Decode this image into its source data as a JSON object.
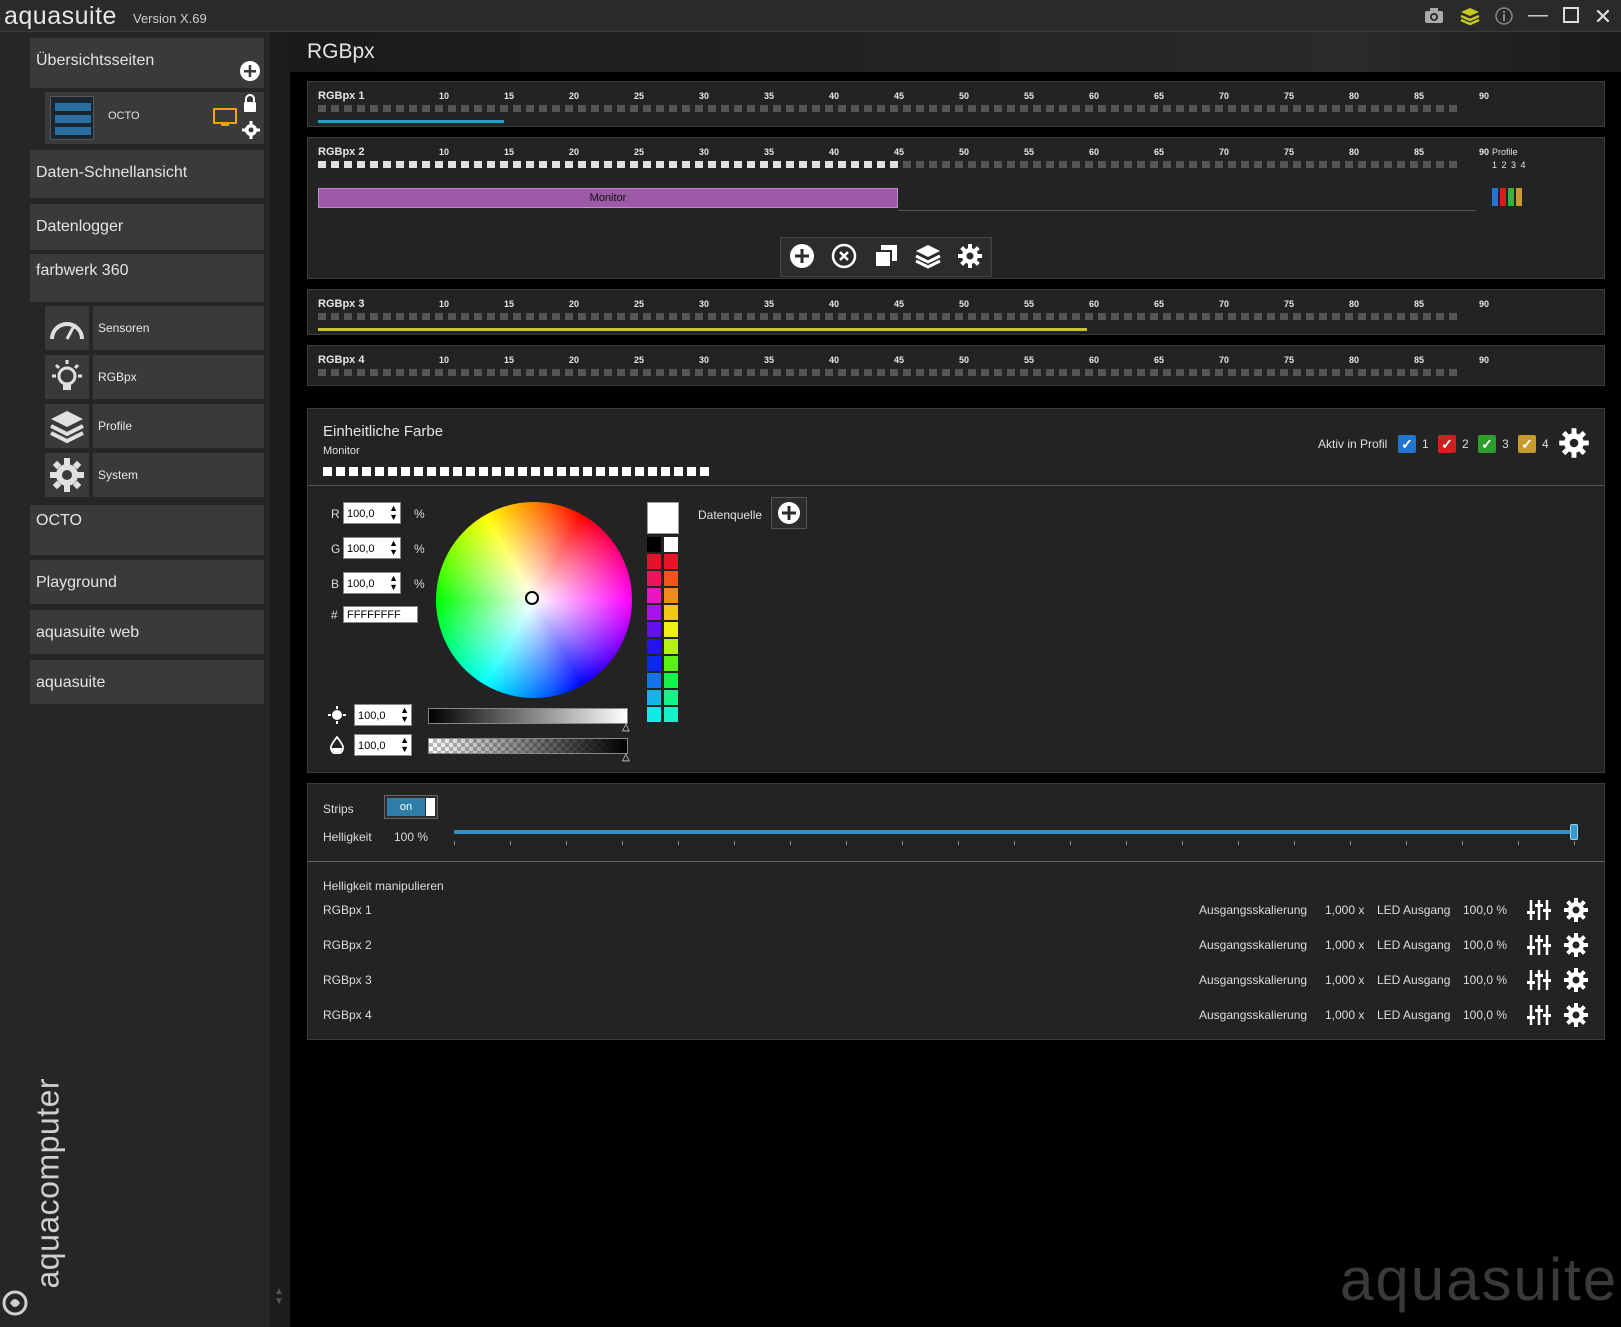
{
  "app": {
    "name": "aquasuite",
    "version": "Version X.69"
  },
  "sidebar": {
    "overview_title": "Übersichtsseiten",
    "octo_card_label": "OCTO",
    "items": [
      {
        "label": "Daten-Schnellansicht"
      },
      {
        "label": "Datenlogger"
      },
      {
        "label": "farbwerk 360"
      }
    ],
    "sub_items": [
      {
        "label": "Sensoren"
      },
      {
        "label": "RGBpx"
      },
      {
        "label": "Profile"
      },
      {
        "label": "System"
      }
    ],
    "items_after": [
      {
        "label": "OCTO"
      },
      {
        "label": "Playground"
      },
      {
        "label": "aquasuite web"
      },
      {
        "label": "aquasuite"
      }
    ],
    "brand_vertical": "aquacomputer"
  },
  "page": {
    "title": "RGBpx"
  },
  "strips": [
    {
      "name": "RGBpx 1",
      "lit_leds": 0,
      "bar_color": "#1aa3c8",
      "bar_fraction": 0.16
    },
    {
      "name": "RGBpx 2",
      "lit_leds": 45,
      "bar_color": "",
      "bar_fraction": 0
    },
    {
      "name": "RGBpx 3",
      "lit_leds": 0,
      "bar_color": "#c7c72a",
      "bar_fraction": 0.66
    },
    {
      "name": "RGBpx 4",
      "lit_leds": 0,
      "bar_color": "",
      "bar_fraction": 0
    }
  ],
  "ticks": [
    "10",
    "15",
    "20",
    "25",
    "30",
    "35",
    "40",
    "45",
    "50",
    "55",
    "60",
    "65",
    "70",
    "75",
    "80",
    "85",
    "90"
  ],
  "strip2": {
    "profile_label": "Profile",
    "profile_numbers": "1 2 3 4",
    "effect_label": "Monitor",
    "effect_color": "#9b59a6",
    "profile_colors": [
      "#2176d2",
      "#d02020",
      "#3fae3f",
      "#c99a2e"
    ]
  },
  "effect": {
    "title": "Einheitliche Farbe",
    "subtitle": "Monitor",
    "active_in_profile_label": "Aktiv in Profil",
    "profiles": [
      {
        "num": "1",
        "color": "#2176d2"
      },
      {
        "num": "2",
        "color": "#d02020"
      },
      {
        "num": "3",
        "color": "#2c9e2c"
      },
      {
        "num": "4",
        "color": "#c99a2e"
      }
    ],
    "led_count": 30,
    "r_label": "R",
    "r_value": "100,0",
    "g_label": "G",
    "g_value": "100,0",
    "b_label": "B",
    "b_value": "100,0",
    "pct": "%",
    "hex_label": "#",
    "hex_value": "FFFFFFFF",
    "brightness_value": "100,0",
    "opacity_value": "100,0",
    "data_source_label": "Datenquelle",
    "palette_left": [
      "#000000",
      "#e0142c",
      "#e8165a",
      "#e619c0",
      "#a514e8",
      "#6214e8",
      "#2414e8",
      "#0a2ae8",
      "#1473e8",
      "#14b4e8",
      "#14e8e8"
    ],
    "palette_right": [
      "#ffffff",
      "#e81428",
      "#f0561a",
      "#f08a1a",
      "#f0c81a",
      "#f0f01a",
      "#b4f01a",
      "#5af01a",
      "#1af04a",
      "#1af08a",
      "#1af0c8"
    ]
  },
  "strips_control": {
    "strips_label": "Strips",
    "toggle_label": "on",
    "brightness_label": "Helligkeit",
    "brightness_value": "100 %",
    "brightness_fraction": 1.0,
    "manipulate_title": "Helligkeit manipulieren",
    "rows": [
      {
        "name": "RGBpx 1",
        "scale_label": "Ausgangsskalierung",
        "scale_value": "1,000 x",
        "led_label": "LED Ausgang",
        "led_value": "100,0 %"
      },
      {
        "name": "RGBpx 2",
        "scale_label": "Ausgangsskalierung",
        "scale_value": "1,000 x",
        "led_label": "LED Ausgang",
        "led_value": "100,0 %"
      },
      {
        "name": "RGBpx 3",
        "scale_label": "Ausgangsskalierung",
        "scale_value": "1,000 x",
        "led_label": "LED Ausgang",
        "led_value": "100,0 %"
      },
      {
        "name": "RGBpx 4",
        "scale_label": "Ausgangsskalierung",
        "scale_value": "1,000 x",
        "led_label": "LED Ausgang",
        "led_value": "100,0 %"
      }
    ]
  },
  "watermark": "aquasuite"
}
